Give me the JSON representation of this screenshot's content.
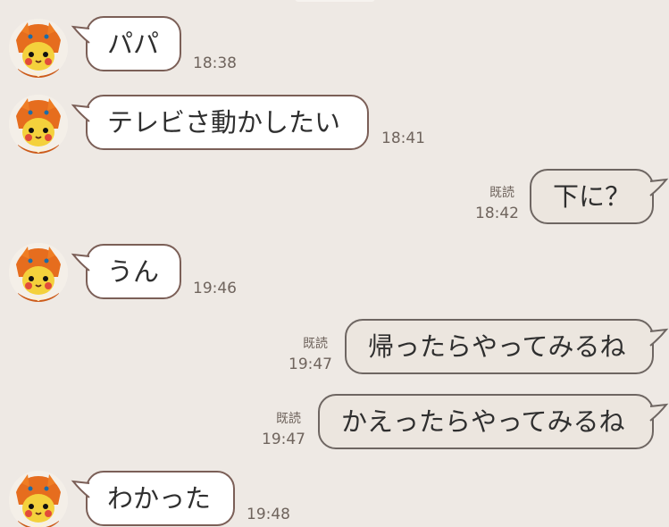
{
  "messages": [
    {
      "text": "パパ",
      "time": "18:38"
    },
    {
      "text": "テレビさ動かしたい",
      "time": "18:41"
    },
    {
      "text": "下に？",
      "time": "18:42",
      "read": "既読"
    },
    {
      "text": "うん",
      "time": "19:46"
    },
    {
      "text": "帰ったらやってみるね",
      "time": "19:47",
      "read": "既読"
    },
    {
      "text": "かえったらやってみるね",
      "time": "19:47",
      "read": "既読"
    },
    {
      "text": "わかった",
      "time": "19:48"
    }
  ],
  "colors": {
    "background": "#eee9e4",
    "incoming_bubble": "#ffffff",
    "outgoing_bubble": "#ece6df",
    "bubble_border": "#7b5f57",
    "timestamp": "#6f645d"
  },
  "icons": {
    "avatar": "pikachu-in-charizard-costume-avatar"
  }
}
